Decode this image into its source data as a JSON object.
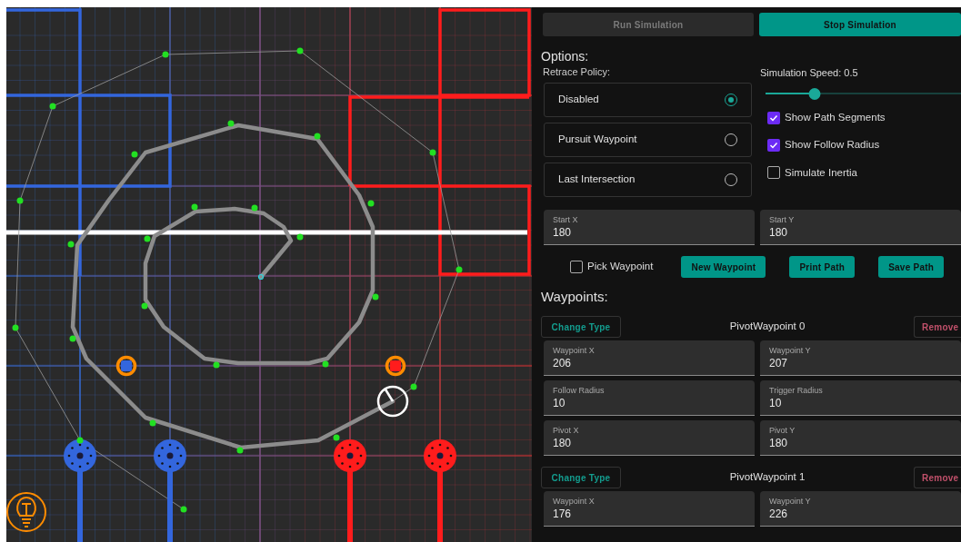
{
  "controls": [
    {
      "label": "Run Simulation",
      "disabled": true
    },
    {
      "label": "Stop Simulation",
      "disabled": false
    }
  ],
  "options": {
    "heading": "Options:",
    "retrace_label": "Retrace Policy:",
    "retrace_policies": [
      {
        "label": "Disabled",
        "selected": true
      },
      {
        "label": "Pursuit Waypoint",
        "selected": false
      },
      {
        "label": "Last Intersection",
        "selected": false
      }
    ],
    "speed": {
      "label": "Simulation Speed: 0.5",
      "level": 0.25
    },
    "toggles": [
      {
        "label": "Show Path Segments",
        "checked": true
      },
      {
        "label": "Show Follow Radius",
        "checked": true
      },
      {
        "label": "Simulate Inertia",
        "checked": false
      }
    ]
  },
  "start_fields": [
    {
      "label": "Start X",
      "value": "180"
    },
    {
      "label": "Start Y",
      "value": "180"
    }
  ],
  "pick_waypoint": {
    "label": "Pick Waypoint",
    "checked": false
  },
  "actions": [
    "New Waypoint",
    "Print Path",
    "Save Path"
  ],
  "waypoints_heading": "Waypoints:",
  "waypoints": [
    {
      "change_label": "Change Type",
      "title": "PivotWaypoint 0",
      "remove_label": "Remove",
      "fields": [
        {
          "label": "Waypoint X",
          "value": "206"
        },
        {
          "label": "Waypoint Y",
          "value": "207"
        },
        {
          "label": "Follow Radius",
          "value": "10"
        },
        {
          "label": "Trigger Radius",
          "value": "10"
        },
        {
          "label": "Pivot X",
          "value": "180"
        },
        {
          "label": "Pivot Y",
          "value": "180"
        }
      ]
    },
    {
      "change_label": "Change Type",
      "title": "PivotWaypoint 1",
      "remove_label": "Remove",
      "fields": [
        {
          "label": "Waypoint X",
          "value": "176"
        },
        {
          "label": "Waypoint Y",
          "value": "226"
        }
      ]
    }
  ]
}
